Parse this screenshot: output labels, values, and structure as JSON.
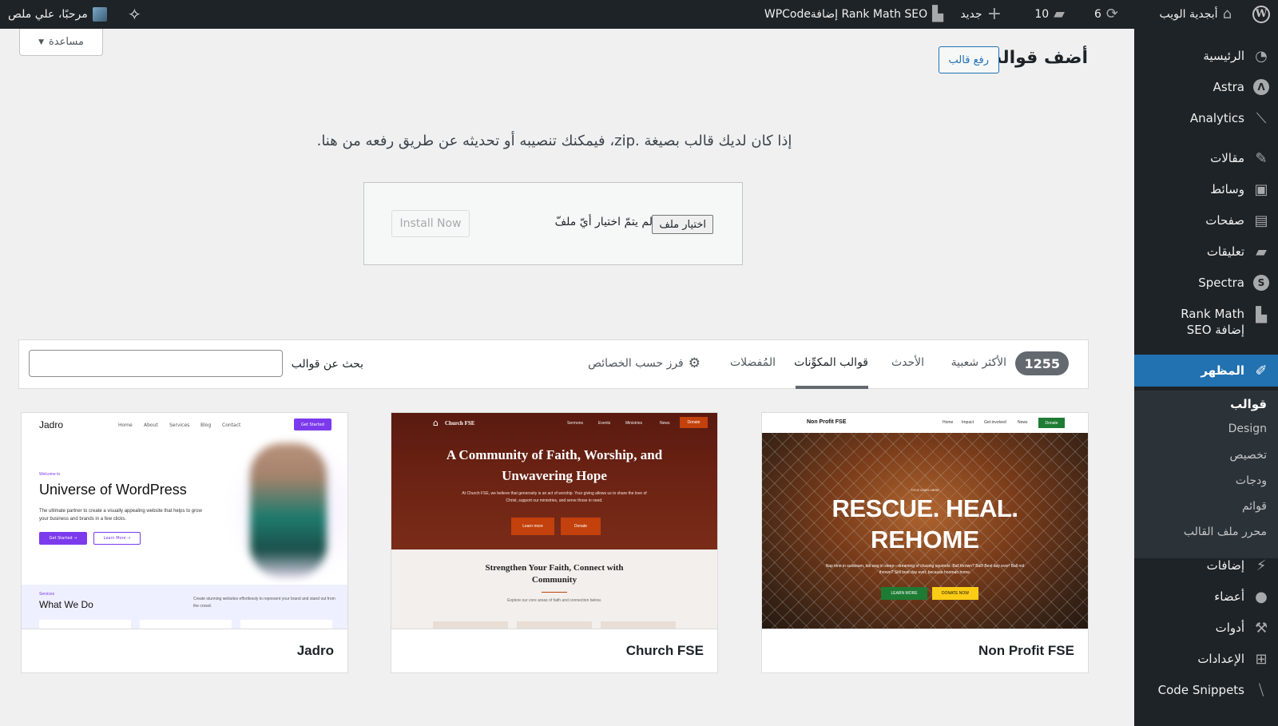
{
  "adminbar": {
    "site_name": "أبجدية الويب",
    "updates_count": "6",
    "comments_count": "10",
    "new_label": "جديد",
    "rank_math": "Rank Math SEO إضافة",
    "wpcode": "WPCode",
    "greeting": "مرحبًا، علي ملص"
  },
  "sidebar": {
    "items": [
      {
        "label": "الرئيسية",
        "icon": "dashboard-icon"
      },
      {
        "label": "Astra",
        "icon": "astra-icon"
      },
      {
        "label": "Analytics",
        "icon": "analytics-icon"
      },
      {
        "label": "مقالات",
        "icon": "pin-icon"
      },
      {
        "label": "وسائط",
        "icon": "media-icon"
      },
      {
        "label": "صفحات",
        "icon": "pages-icon"
      },
      {
        "label": "تعليقات",
        "icon": "comments-icon"
      },
      {
        "label": "Spectra",
        "icon": "spectra-icon"
      },
      {
        "label": "Rank Math إضافة SEO",
        "icon": "rankmath-icon"
      },
      {
        "label": "المظهر",
        "icon": "brush-icon"
      },
      {
        "label": "إضافات",
        "icon": "plugins-icon"
      },
      {
        "label": "أعضاء",
        "icon": "users-icon"
      },
      {
        "label": "أدوات",
        "icon": "tools-icon"
      },
      {
        "label": "الإعدادات",
        "icon": "settings-icon"
      },
      {
        "label": "Code Snippets",
        "icon": "code-snippets-icon"
      }
    ],
    "submenu": [
      "قوالب",
      "Design",
      "تخصيص",
      "ودجات",
      "قوائم",
      "محرر ملف القالب"
    ]
  },
  "main": {
    "help_label": "مساعدة",
    "page_title": "أضف قوالب",
    "upload_button": "رفع قالب",
    "upload_message": "إذا كان لديك قالب بصيغة .zip، فيمكنك تنصيبه أو تحديثه عن طريق رفعه من هنا.",
    "choose_file": "اختيار ملف",
    "no_file": "لم يتمّ اختيار أيّ ملفّ",
    "install_now": "Install Now"
  },
  "filter": {
    "count": "1255",
    "tabs": [
      "الأكثر شعبية",
      "الأحدث",
      "قوالب المكوِّنات",
      "المُفضلات"
    ],
    "feature_filter": "فرز حسب الخصائص",
    "search_label": "بحث عن قوالب"
  },
  "themes": [
    {
      "name": "Non Profit FSE",
      "site": "Non Profit FSE",
      "nav": [
        "Home",
        "Impact",
        "Get involved",
        "News"
      ],
      "cta": "Donate",
      "kicker": "TITLE GOES HERE",
      "headline1": "RESCUE. HEAL.",
      "headline2": "REHOME",
      "body": "Nap time in sunbeam, tail wag in sleep—dreaming of chasing squirrels. Ball thrown? Ball! Best day ever! Ball not thrown? Still best day ever, because hooman home.",
      "btn1": "LEARN MORE",
      "btn2": "DONATE NOW"
    },
    {
      "name": "Church FSE",
      "site": "Church FSE",
      "nav": [
        "Sermons",
        "Events",
        "Ministries",
        "News"
      ],
      "cta": "Donate",
      "headline": "A Community of Faith, Worship, and Unwavering Hope",
      "body": "At Church FSE, we believe that generosity is an act of worship. Your giving allows us to share the love of Christ, support our ministries, and serve those in need.",
      "btn1": "Learn more",
      "btn2": "Donate",
      "section_title": "Strengthen Your Faith, Connect with Community",
      "section_sub": "Explore our core areas of faith and connection below."
    },
    {
      "name": "Jadro",
      "site": "Jadro",
      "nav": [
        "Home",
        "About",
        "Services",
        "Blog",
        "Contact"
      ],
      "cta": "Get Started",
      "kicker": "Welcome to",
      "headline": "Universe of WordPress",
      "body": "The ultimate partner to create a visually appealing website that helps to grow your business and brands in a few clicks.",
      "btn1": "Get Started →",
      "btn2": "Learn More →",
      "services_kicker": "Services",
      "services_title": "What We Do",
      "services_body": "Create stunning websites effortlessly to represent your brand and stand out from the crowd."
    }
  ],
  "colors": {
    "accent": "#2271b1",
    "admin_dark": "#1d2327",
    "jadro_violet": "#7c3aed",
    "church_red": "#c2410c",
    "nonprofit_green": "#1e7b34",
    "nonprofit_yellow": "#facc15"
  }
}
